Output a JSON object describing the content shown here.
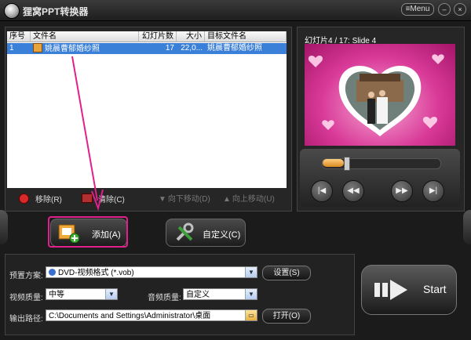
{
  "title_bar": {
    "app_title": "狸窝PPT转换器",
    "menu_label": "Menu",
    "minimize": "–",
    "close": "×"
  },
  "file_list": {
    "columns": [
      "序号",
      "文件名",
      "幻灯片数",
      "大小",
      "目标文件名"
    ],
    "rows": [
      {
        "index": "1",
        "filename": "姚晨曹郁婚纱照",
        "slides": "17",
        "size": "22,0...",
        "target": "姚晨曹郁婚纱照"
      }
    ]
  },
  "list_actions": {
    "remove": "移除(R)",
    "clear": "清除(C)",
    "move_down": "向下移动(D)",
    "move_up": "向上移动(U)"
  },
  "preview": {
    "label": "幻灯片4 / 17: Slide 4"
  },
  "player": {
    "progress_fraction": 0.18,
    "btn_first": "|◀",
    "btn_prev": "◀◀",
    "btn_next": "▶▶",
    "btn_last": "▶|"
  },
  "main_buttons": {
    "add": "添加(A)",
    "customize": "自定义(C)"
  },
  "settings": {
    "preset_label": "预置方案:",
    "preset_value": "DVD-视频格式 (*.vob)",
    "settings_button": "设置(S)",
    "video_quality_label": "视频质量:",
    "video_quality_value": "中等",
    "audio_quality_label": "音频质量:",
    "audio_quality_value": "自定义",
    "output_path_label": "输出路径:",
    "output_path_value": "C:\\Documents and Settings\\Administrator\\桌面",
    "open_button": "打开(O)"
  },
  "start_button": {
    "label": "Start"
  },
  "colors": {
    "highlight": "#e0208c",
    "selection": "#3a7fd8"
  }
}
